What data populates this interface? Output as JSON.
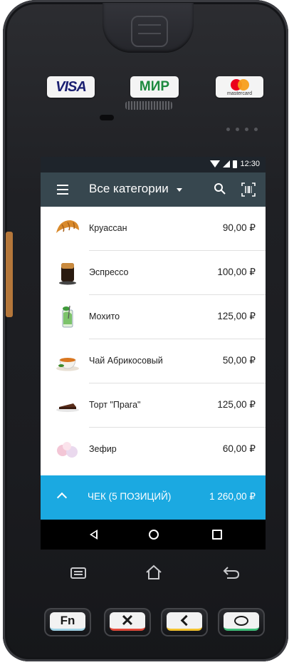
{
  "status": {
    "time": "12:30"
  },
  "payment_logos": {
    "visa": "VISA",
    "mir": "МИР",
    "mastercard": "mastercard"
  },
  "toolbar": {
    "title": "Все категории"
  },
  "products": [
    {
      "name": "Круассан",
      "price": "90,00 ₽",
      "icon": "croissant"
    },
    {
      "name": "Эспрессо",
      "price": "100,00 ₽",
      "icon": "espresso-cup"
    },
    {
      "name": "Мохито",
      "price": "125,00 ₽",
      "icon": "mojito-glass"
    },
    {
      "name": "Чай Абрикосовый",
      "price": "50,00 ₽",
      "icon": "tea-cup"
    },
    {
      "name": "Торт \"Прага\"",
      "price": "125,00 ₽",
      "icon": "cake-slice"
    },
    {
      "name": "Зефир",
      "price": "60,00 ₽",
      "icon": "marshmallow"
    }
  ],
  "checkout": {
    "label": "ЧЕК (5 ПОЗИЦИЙ)",
    "total": "1 260,00 ₽"
  },
  "hardware_keys": {
    "fn": "Fn"
  },
  "colors": {
    "toolbar": "#37474f",
    "accent": "#1ba9e1",
    "statusbar": "#1e242b"
  }
}
